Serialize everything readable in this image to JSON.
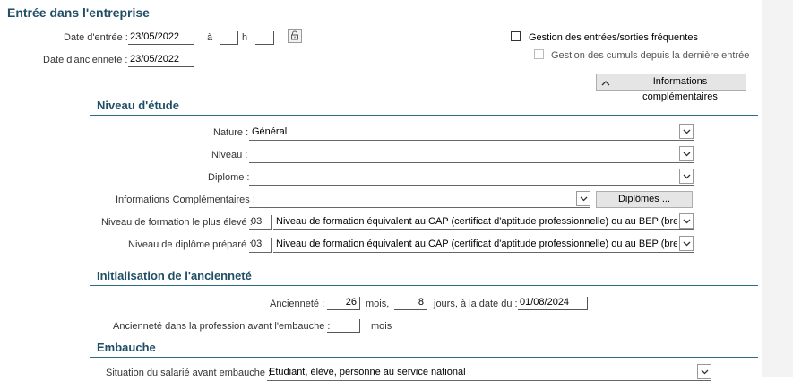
{
  "header": {
    "title": "Entrée dans l'entreprise"
  },
  "entry": {
    "date_label": "Date d'entrée :",
    "date_value": "23/05/2022",
    "a_label": "à",
    "h_label": "h",
    "hour_value": "",
    "minute_value": "",
    "seniority_label": "Date d'ancienneté :",
    "seniority_value": "23/05/2022",
    "frequent_label": "Gestion des entrées/sorties fréquentes",
    "cumuls_label": "Gestion des cumuls depuis la dernière entrée",
    "info_button": "Informations complémentaires"
  },
  "education": {
    "section_title": "Niveau d'étude",
    "nature_label": "Nature :",
    "nature_value": "Général",
    "niveau_label": "Niveau :",
    "niveau_value": "",
    "diplome_label": "Diplome :",
    "diplome_value": "",
    "info_label": "Informations Complémentaires :",
    "info_value": "",
    "diplomes_button": "Diplômes ...",
    "formation_label": "Niveau de formation le plus élevé :",
    "formation_code": "03",
    "formation_value": "Niveau de formation équivalent au CAP (certificat d'aptitude professionnelle) ou au BEP (brevet",
    "prepare_label": "Niveau de diplôme préparé :",
    "prepare_code": "03",
    "prepare_value": "Niveau de formation équivalent au CAP (certificat d'aptitude professionnelle) ou au BEP (brevet"
  },
  "seniority": {
    "section_title": "Initialisation de l'ancienneté",
    "anciennete_label": "Ancienneté :",
    "months_value": "26",
    "months_label": "mois,",
    "days_value": "8",
    "days_label": "jours, à la date du :",
    "date_value": "01/08/2024",
    "profession_label": "Ancienneté dans la profession avant l'embauche :",
    "profession_value": "",
    "profession_unit": "mois"
  },
  "hiring": {
    "section_title": "Embauche",
    "situation_label": "Situation du salarié avant embauche :",
    "situation_value": "Etudiant, élève, personne au service national"
  },
  "colors": {
    "accent": "#1f4e66",
    "rule": "#2f6a80"
  }
}
